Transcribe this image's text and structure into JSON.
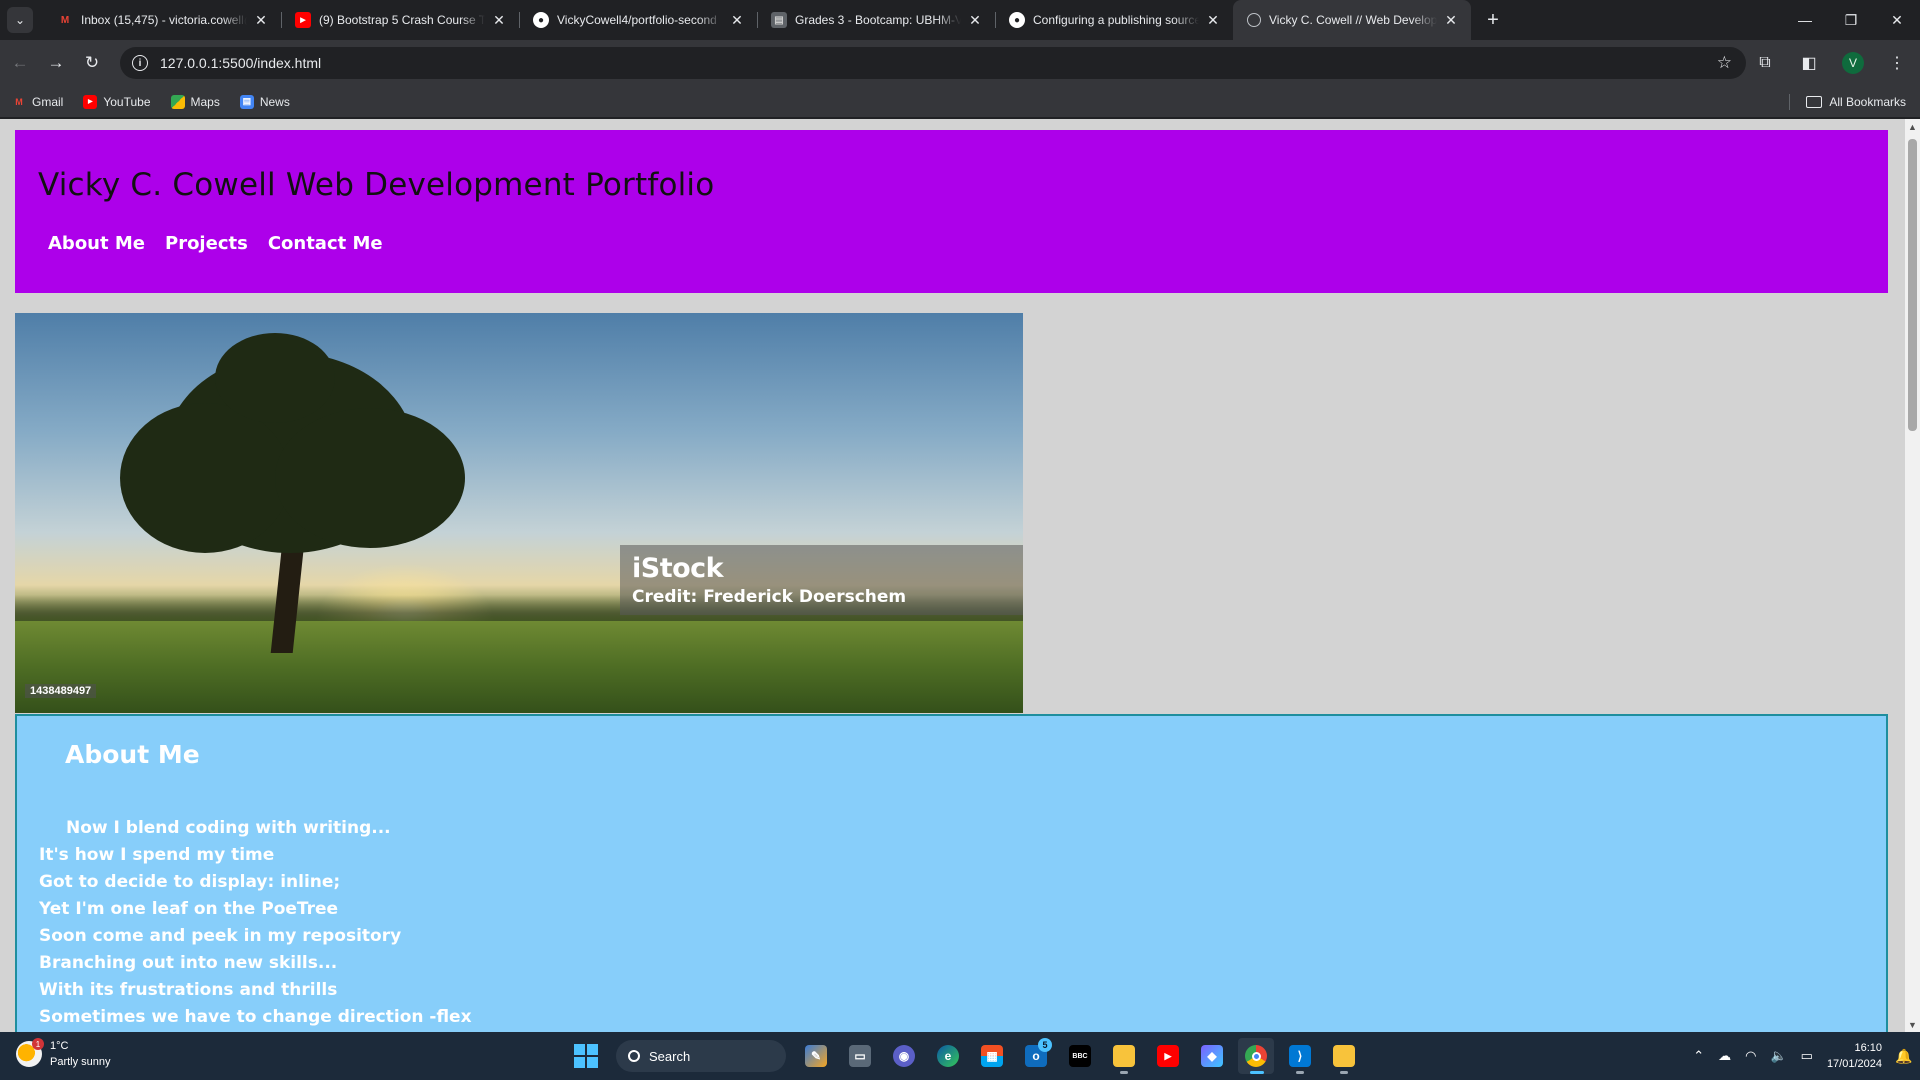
{
  "browser": {
    "tabs": [
      {
        "title": "Inbox (15,475) - victoria.cowell@",
        "icon": "gmail-icon",
        "color": "#ea4335"
      },
      {
        "title": "(9) Bootstrap 5 Crash Course Tu",
        "icon": "youtube-icon",
        "color": "#ff0000"
      },
      {
        "title": "VickyCowell4/portfolio-second",
        "icon": "github-icon",
        "color": "#ffffff"
      },
      {
        "title": "Grades 3 - Bootcamp: UBHM-V",
        "icon": "canvas-icon",
        "color": "#8a8a8a"
      },
      {
        "title": "Configuring a publishing source",
        "icon": "github-icon",
        "color": "#ffffff"
      },
      {
        "title": "Vicky C. Cowell // Web Develop",
        "icon": "globe-icon",
        "color": "#bdc1c6"
      }
    ],
    "active_tab": 5,
    "url": "127.0.0.1:5500/index.html",
    "profile_initial": "V",
    "bookmarks": [
      {
        "label": "Gmail",
        "icon": "gmail-icon"
      },
      {
        "label": "YouTube",
        "icon": "youtube-icon"
      },
      {
        "label": "Maps",
        "icon": "maps-icon"
      },
      {
        "label": "News",
        "icon": "news-icon"
      }
    ],
    "all_bookmarks_label": "All Bookmarks"
  },
  "page": {
    "title": "Vicky C. Cowell Web Development Portfolio",
    "nav": [
      "About Me",
      "Projects",
      "Contact Me"
    ],
    "hero": {
      "watermark_brand": "iStock",
      "watermark_credit": "Credit: Frederick Doerschem",
      "image_id": "1438489497"
    },
    "about": {
      "heading": "About Me",
      "lines": [
        "Now I blend coding with writing...",
        "It's how I spend my time",
        "Got to decide to display: inline;",
        "Yet I'm one leaf on the PoeTree",
        "Soon come and peek in my repository",
        "Branching out into new skills...",
        "With its frustrations and thrills",
        "Sometimes we have to change direction -flex"
      ]
    },
    "colors": {
      "header_bg": "#ad00ea",
      "about_bg": "#87cefa",
      "page_bg": "#d3d3d3"
    }
  },
  "taskbar": {
    "weather": {
      "temp": "1°C",
      "condition": "Partly sunny",
      "badge": "1"
    },
    "search_label": "Search",
    "apps": [
      {
        "name": "widgets-app",
        "glyph": "🖌"
      },
      {
        "name": "task-view-app",
        "glyph": "▭"
      },
      {
        "name": "chat-app",
        "glyph": "◉"
      },
      {
        "name": "edge-app",
        "glyph": "e"
      },
      {
        "name": "store-app",
        "glyph": "▦"
      },
      {
        "name": "outlook-app",
        "glyph": "o",
        "badge": "5"
      },
      {
        "name": "news-app",
        "glyph": "BBC"
      },
      {
        "name": "file-explorer-app",
        "glyph": "▬"
      },
      {
        "name": "youtube-app",
        "glyph": "▶"
      },
      {
        "name": "copilot-app",
        "glyph": "◆"
      },
      {
        "name": "chrome-app",
        "glyph": "◎"
      },
      {
        "name": "vscode-app",
        "glyph": "⟩"
      },
      {
        "name": "notes-app",
        "glyph": "▮"
      }
    ],
    "time": "16:10",
    "date": "17/01/2024"
  }
}
